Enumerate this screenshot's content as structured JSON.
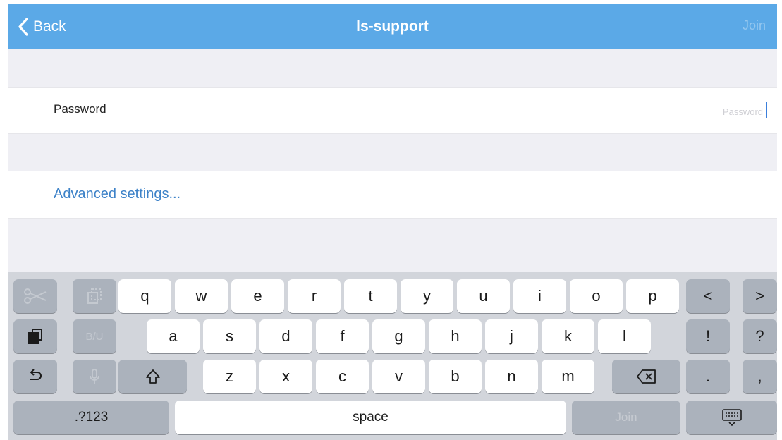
{
  "colors": {
    "nav_bar": "#5ba9e7",
    "link": "#3d82c8",
    "keyboard_bg": "#d2d5db",
    "dark_key": "#abb2bc"
  },
  "nav": {
    "back_label": "Back",
    "title": "ls-support",
    "join_label": "Join"
  },
  "form": {
    "password_label": "Password",
    "password_placeholder": "Password",
    "password_value": "",
    "advanced_label": "Advanced settings..."
  },
  "keyboard": {
    "row1": [
      "q",
      "w",
      "e",
      "r",
      "t",
      "y",
      "u",
      "i",
      "o",
      "p"
    ],
    "row2": [
      "a",
      "s",
      "d",
      "f",
      "g",
      "h",
      "j",
      "k",
      "l"
    ],
    "row3": [
      "z",
      "x",
      "c",
      "v",
      "b",
      "n",
      "m"
    ],
    "nav_left": "<",
    "nav_right": ">",
    "exclaim": "!",
    "question": "?",
    "period": ".",
    "comma": ",",
    "bold_underline": "B/U",
    "numbers_label": ".?123",
    "space_label": "space",
    "join_label": "Join",
    "icons": [
      "scissors-icon",
      "copy-icon",
      "paste-icon",
      "undo-icon",
      "microphone-icon",
      "shift-icon",
      "backspace-icon",
      "hide-keyboard-icon"
    ]
  }
}
